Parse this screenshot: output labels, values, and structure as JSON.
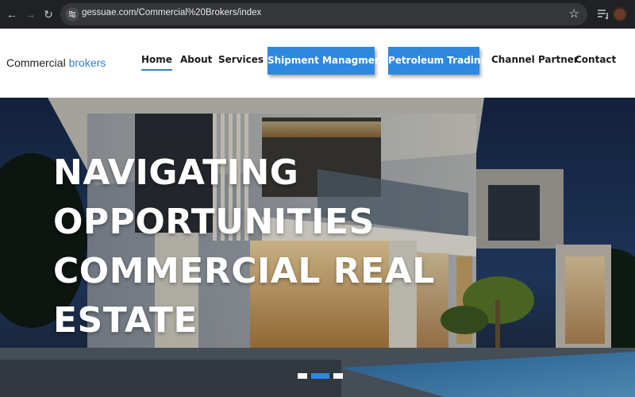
{
  "browser": {
    "url": "gessuae.com/Commercial%20Brokers/index",
    "back_icon": "arrow-left-icon",
    "forward_icon": "arrow-right-icon",
    "reload_icon": "reload-icon",
    "bookmark_icon": "star-icon"
  },
  "header": {
    "logo_main": "Commercial",
    "logo_accent": "brokers",
    "nav": {
      "home": "Home",
      "about": "About",
      "services": "Services",
      "shipment": "Shipment Managment",
      "petroleum": "Petroleum Trading",
      "channel": "Channel Partner",
      "contact": "Contact"
    }
  },
  "hero": {
    "lines": [
      "NAVIGATING",
      "OPPORTUNITIES",
      "COMMERCIAL REAL",
      "ESTATE"
    ],
    "active_slide": 2,
    "slide_count": 3
  },
  "colors": {
    "accent": "#2f88e0",
    "chrome_bg": "#202124",
    "omnibox_bg": "#35363a"
  }
}
